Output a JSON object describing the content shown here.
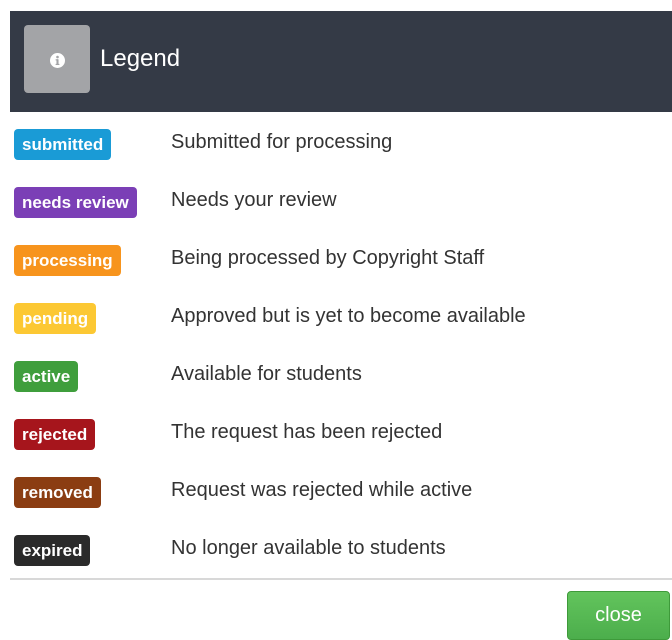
{
  "header": {
    "title": "Legend",
    "icon": "info-icon"
  },
  "legend": {
    "items": [
      {
        "badge": "submitted",
        "description": "Submitted for processing",
        "color": "#1a9bd6"
      },
      {
        "badge": "needs review",
        "description": "Needs your review",
        "color": "#7b3fb6"
      },
      {
        "badge": "processing",
        "description": "Being processed by Copyright Staff",
        "color": "#f7941d"
      },
      {
        "badge": "pending",
        "description": "Approved but is yet to become available",
        "color": "#fcc833"
      },
      {
        "badge": "active",
        "description": "Available for students",
        "color": "#3f9e3c"
      },
      {
        "badge": "rejected",
        "description": "The request has been rejected",
        "color": "#a6151c"
      },
      {
        "badge": "removed",
        "description": "Request was rejected while active",
        "color": "#8b3d12"
      },
      {
        "badge": "expired",
        "description": "No longer available to students",
        "color": "#2a2a2a"
      }
    ]
  },
  "footer": {
    "close_label": "close",
    "close_color": "#5cb85c"
  }
}
